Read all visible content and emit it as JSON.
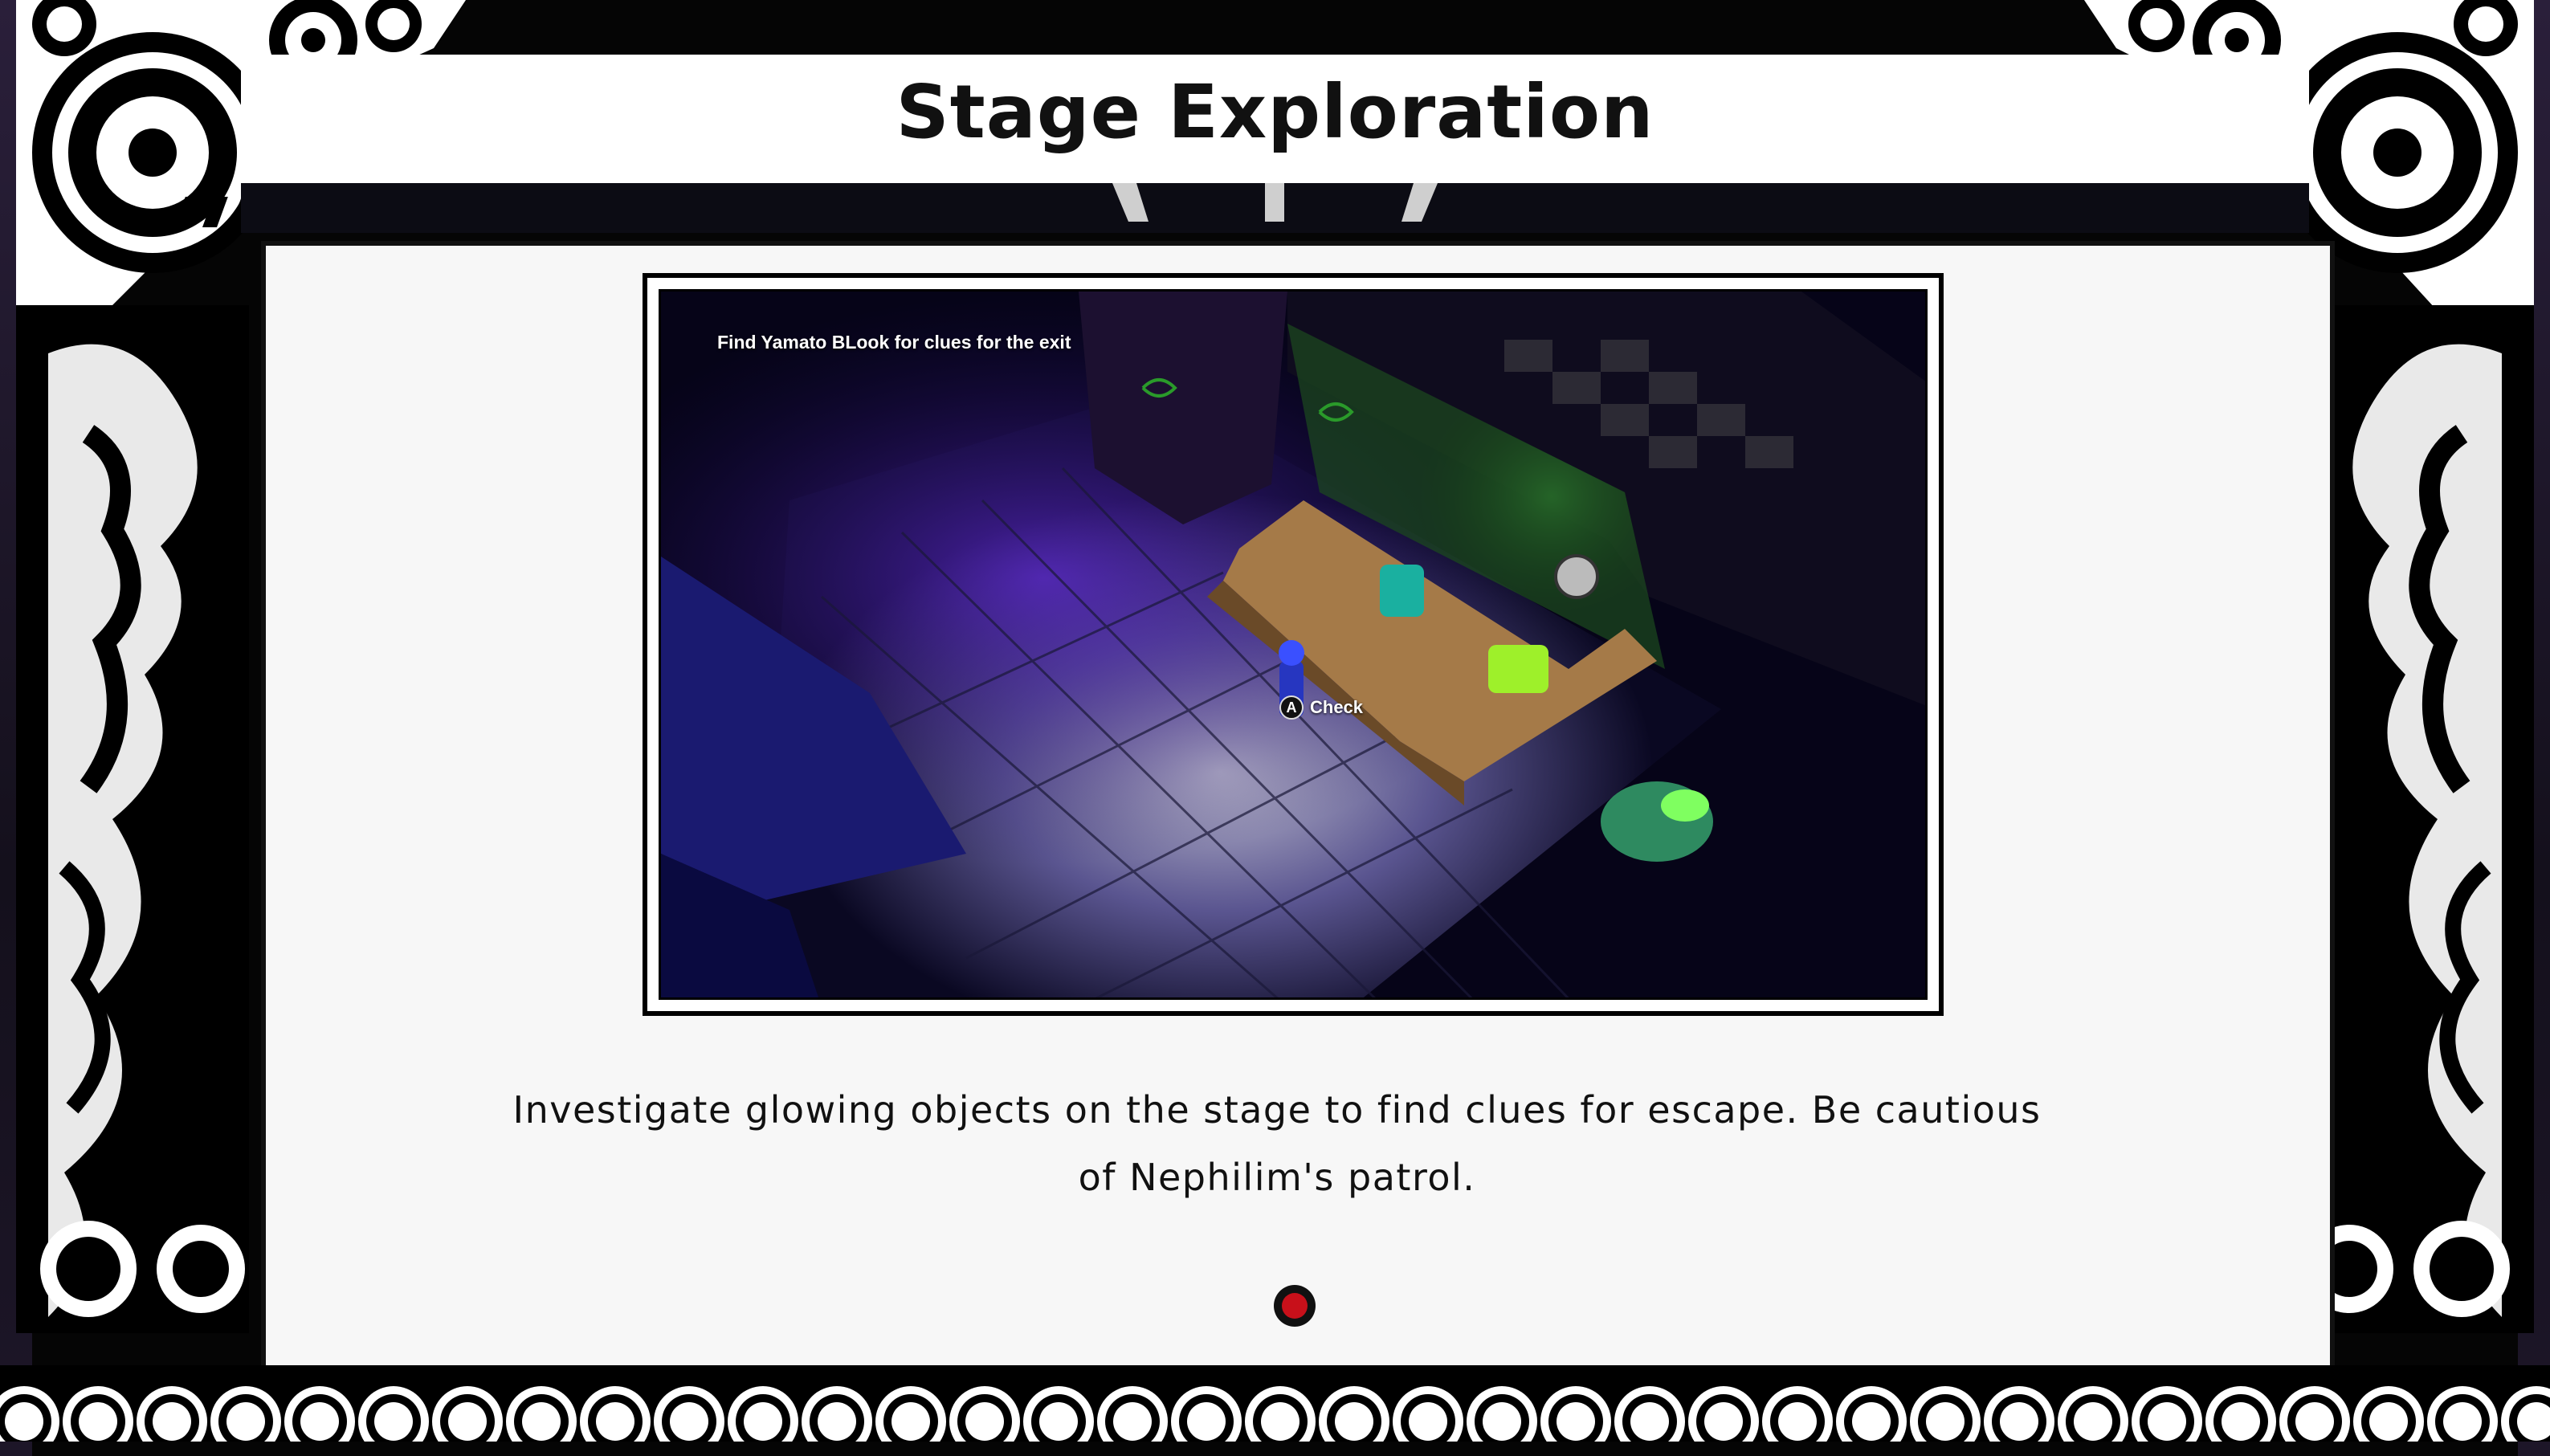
{
  "header": {
    "title": "Stage Exploration"
  },
  "screenshot": {
    "objective_text": "Find Yamato BLook for clues for the exit",
    "prompt": {
      "button_glyph": "A",
      "label": "Check"
    }
  },
  "description": {
    "line1": "Investigate glowing objects on the stage to find clues for escape. Be cautious",
    "line2": "of Nephilim's patrol."
  },
  "pagination": {
    "current": 1,
    "total": 1
  },
  "colors": {
    "accent": "#c8101a",
    "panel": "#f7f7f7",
    "frame": "#000000"
  }
}
